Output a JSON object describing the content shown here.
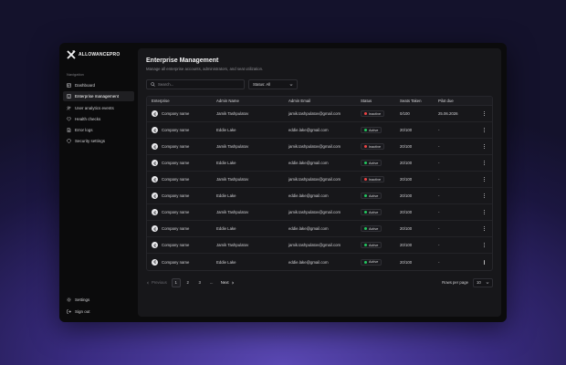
{
  "brand": {
    "name": "ALLOWANCEPRO"
  },
  "sidebar": {
    "section_label": "Navigation",
    "items": [
      {
        "label": "Dashboard",
        "icon": "dashboard-icon"
      },
      {
        "label": "Enterprise management",
        "icon": "building-icon",
        "active": true
      },
      {
        "label": "User analytics events",
        "icon": "users-icon"
      },
      {
        "label": "Health checks",
        "icon": "heart-icon"
      },
      {
        "label": "Error logs",
        "icon": "file-icon"
      },
      {
        "label": "Security settings",
        "icon": "shield-icon"
      }
    ],
    "bottom": [
      {
        "label": "Settings",
        "icon": "gear-icon"
      },
      {
        "label": "Sign out",
        "icon": "logout-icon"
      }
    ]
  },
  "header": {
    "title": "Enterprise Management",
    "subtitle": "Manage all enterprise accounts, administrators, and seat utilization."
  },
  "filters": {
    "search_placeholder": "Search...",
    "status_label": "Status: All"
  },
  "table": {
    "columns": [
      "Enterprise",
      "Admin Name",
      "Admin Email",
      "Status",
      "Seats Taken",
      "Pilot due"
    ],
    "rows": [
      {
        "enterprise": "Company name",
        "admin": "Jamik Tashpulatov",
        "email": "jamik.tashpulatov@gmail.com",
        "status": "Inactive",
        "seats": "0/100",
        "pilot": "25.06.2026"
      },
      {
        "enterprise": "Company name",
        "admin": "Eddie Lake",
        "email": "eddie.lake@gmail.com",
        "status": "Active",
        "seats": "20/100",
        "pilot": "-"
      },
      {
        "enterprise": "Company name",
        "admin": "Jamik Tashpulatov",
        "email": "jamik.tashpulatov@gmail.com",
        "status": "Inactive",
        "seats": "20/100",
        "pilot": "-"
      },
      {
        "enterprise": "Company name",
        "admin": "Eddie Lake",
        "email": "eddie.lake@gmail.com",
        "status": "Active",
        "seats": "20/100",
        "pilot": "-"
      },
      {
        "enterprise": "Company name",
        "admin": "Jamik Tashpulatov",
        "email": "jamik.tashpulatov@gmail.com",
        "status": "Inactive",
        "seats": "20/100",
        "pilot": "-"
      },
      {
        "enterprise": "Company name",
        "admin": "Eddie Lake",
        "email": "eddie.lake@gmail.com",
        "status": "Active",
        "seats": "20/100",
        "pilot": "-"
      },
      {
        "enterprise": "Company name",
        "admin": "Jamik Tashpulatov",
        "email": "jamik.tashpulatov@gmail.com",
        "status": "Active",
        "seats": "20/100",
        "pilot": "-"
      },
      {
        "enterprise": "Company name",
        "admin": "Eddie Lake",
        "email": "eddie.lake@gmail.com",
        "status": "Active",
        "seats": "20/100",
        "pilot": "-"
      },
      {
        "enterprise": "Company name",
        "admin": "Jamik Tashpulatov",
        "email": "jamik.tashpulatov@gmail.com",
        "status": "Active",
        "seats": "20/100",
        "pilot": "-"
      },
      {
        "enterprise": "Company name",
        "admin": "Eddie Lake",
        "email": "eddie.lake@gmail.com",
        "status": "Active",
        "seats": "20/100",
        "pilot": "-"
      }
    ]
  },
  "pagination": {
    "previous": "Previous",
    "pages": [
      "1",
      "2",
      "3",
      "..."
    ],
    "current": "1",
    "next": "Next",
    "rows_per_page_label": "Rows per page",
    "rows_per_page_value": "10"
  },
  "colors": {
    "active_dot": "#22c55e",
    "inactive_dot": "#ef4444",
    "accent": "#4b3aa8"
  }
}
